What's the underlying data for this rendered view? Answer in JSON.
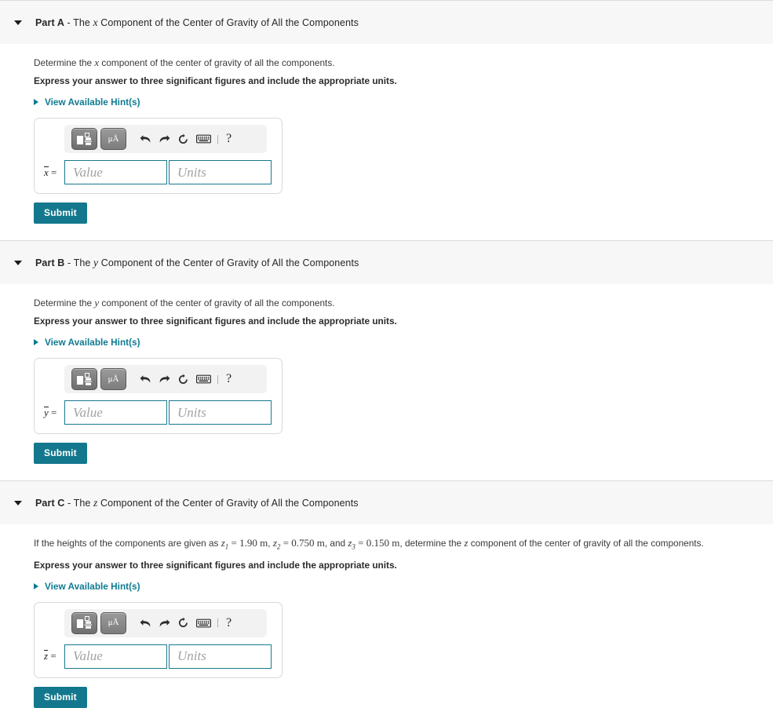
{
  "theme": {
    "accent": "#13788d",
    "link": "#0f7b92",
    "header_bg": "#f7f7f7",
    "field_border": "#19798e",
    "border": "#d8d8d8",
    "text": "#333333"
  },
  "toolbar": {
    "icons": [
      {
        "name": "math-template-button",
        "label": "math template"
      },
      {
        "name": "units-button",
        "label": "μÅ"
      },
      {
        "name": "undo-icon",
        "label": "undo"
      },
      {
        "name": "redo-icon",
        "label": "redo"
      },
      {
        "name": "reset-icon",
        "label": "reset"
      },
      {
        "name": "keyboard-icon",
        "label": "keyboard"
      },
      {
        "name": "help-icon",
        "label": "?"
      }
    ],
    "help_label": "?"
  },
  "common": {
    "hint_label": "View Available Hint(s)",
    "submit_label": "Submit",
    "value_placeholder": "Value",
    "units_placeholder": "Units",
    "value_current": "",
    "units_current": "",
    "equals": "="
  },
  "parts": [
    {
      "id": "part-a",
      "label": "Part A",
      "separator": " - ",
      "title_pre": "The ",
      "title_var": "x",
      "title_post": " Component of the Center of Gravity of All the Components",
      "prompt_pre": "Determine the ",
      "prompt_var": "x",
      "prompt_post": " component of the center of gravity of all the components.",
      "instruction": "Express your answer to three significant figures and include the appropriate units.",
      "answer_var": "x",
      "hint_label": "View Available Hint(s)",
      "submit_label": "Submit"
    },
    {
      "id": "part-b",
      "label": "Part B",
      "separator": " - ",
      "title_pre": "The ",
      "title_var": "y",
      "title_post": " Component of the Center of Gravity of All the Components",
      "prompt_pre": "Determine the ",
      "prompt_var": "y",
      "prompt_post": " component of the center of gravity of all the components.",
      "instruction": "Express your answer to three significant figures and include the appropriate units.",
      "answer_var": "y",
      "hint_label": "View Available Hint(s)",
      "submit_label": "Submit"
    },
    {
      "id": "part-c",
      "label": "Part C",
      "separator": " - ",
      "title_pre": "The ",
      "title_var": "z",
      "title_post": " Component of the Center of Gravity of All the Components",
      "prompt_c": {
        "lead": "If the heights of the components are given as ",
        "z1_sym": "z",
        "z1_sub": "1",
        "z1_val": "1.90 m",
        "mid1": ", ",
        "z2_sym": "z",
        "z2_sub": "2",
        "z2_val": "0.750 m",
        "mid2": ", and ",
        "z3_sym": "z",
        "z3_sub": "3",
        "z3_val": "0.150 m",
        "tail_pre": ", determine the ",
        "tail_var": "z",
        "tail_post": " component of the center of gravity of all the components."
      },
      "instruction": "Express your answer to three significant figures and include the appropriate units.",
      "answer_var": "z",
      "hint_label": "View Available Hint(s)",
      "submit_label": "Submit"
    }
  ]
}
